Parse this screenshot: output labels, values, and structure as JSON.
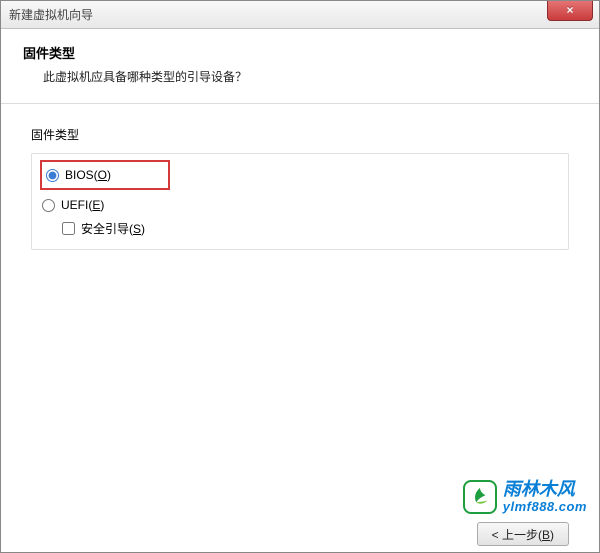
{
  "window": {
    "title": "新建虚拟机向导",
    "close_glyph": "×"
  },
  "header": {
    "title": "固件类型",
    "subtitle": "此虚拟机应具备哪种类型的引导设备？"
  },
  "group": {
    "label": "固件类型"
  },
  "options": {
    "bios": {
      "label": "BIOS(",
      "hotkey": "O",
      "suffix": ")",
      "checked": true
    },
    "uefi": {
      "label": "UEFI(",
      "hotkey": "E",
      "suffix": ")",
      "checked": false
    },
    "secure_boot": {
      "label": "安全引导(",
      "hotkey": "S",
      "suffix": ")",
      "checked": false
    }
  },
  "footer": {
    "back": {
      "prefix": "< 上一步(",
      "hotkey": "B",
      "suffix": ")"
    }
  },
  "watermark": {
    "brand": "雨林木风",
    "url": "ylmf888.com"
  }
}
